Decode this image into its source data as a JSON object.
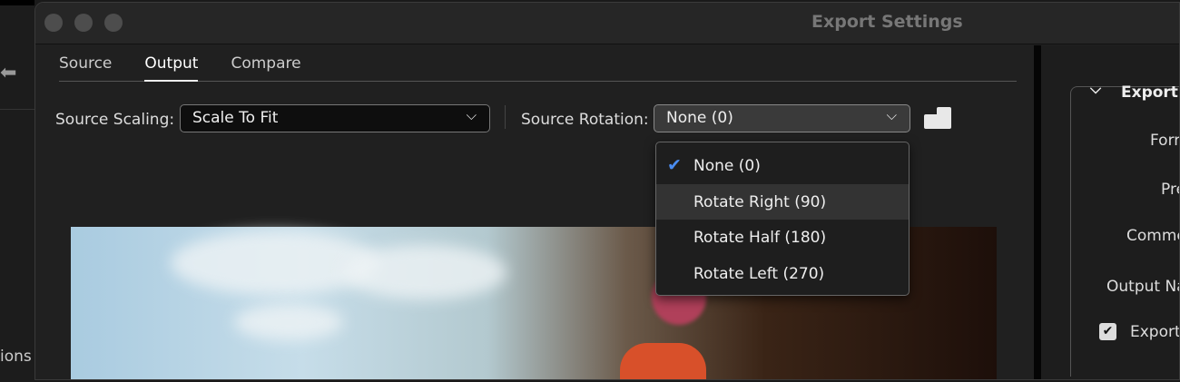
{
  "window": {
    "title": "Export Settings"
  },
  "left_strip": {
    "back_icon": "arrow-left",
    "partial_label": "ions"
  },
  "tabs": [
    {
      "label": "Source"
    },
    {
      "label": "Output",
      "active": true
    },
    {
      "label": "Compare"
    }
  ],
  "source_scaling": {
    "label": "Source Scaling:",
    "value": "Scale To Fit"
  },
  "source_rotation": {
    "label": "Source Rotation:",
    "value": "None (0)"
  },
  "rotation_menu": {
    "items": [
      {
        "label": "None (0)",
        "selected": true
      },
      {
        "label": "Rotate Right (90)",
        "hovered": true
      },
      {
        "label": "Rotate Half (180)"
      },
      {
        "label": "Rotate Left (270)"
      }
    ]
  },
  "right_panel": {
    "section_title": "Export S",
    "labels": {
      "format": "Forr",
      "preset": "Pre",
      "comments": "Comme",
      "output_name": "Output Na",
      "export": "Export"
    },
    "export_checked": true
  },
  "colors": {
    "accent": "#4a8cf0"
  }
}
